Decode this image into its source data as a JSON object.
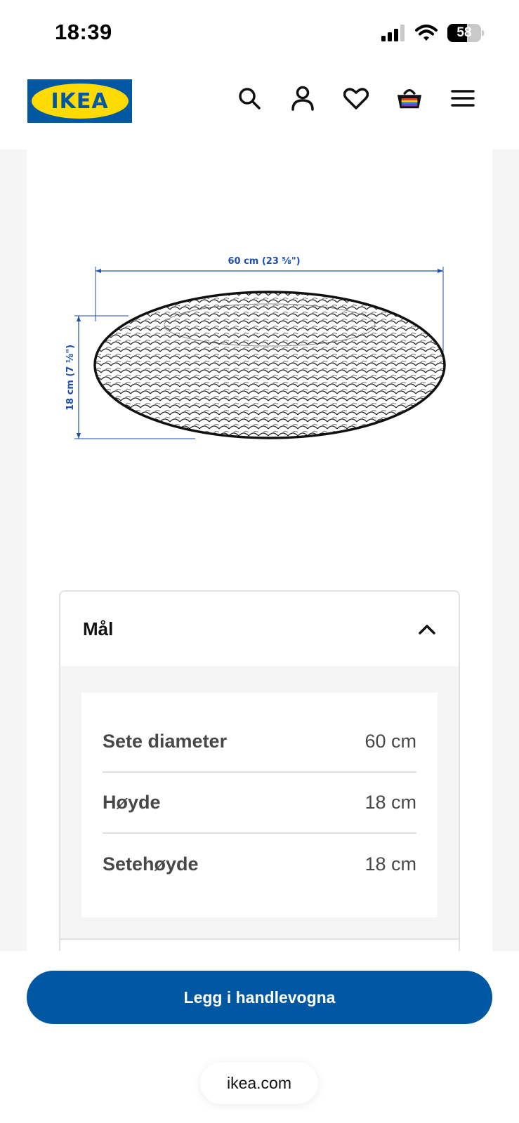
{
  "status_bar": {
    "time": "18:39",
    "battery_level": "58",
    "battery_fraction": 0.58,
    "icons": [
      "cellular-signal-icon",
      "wifi-icon",
      "battery-icon"
    ]
  },
  "header": {
    "logo_text": "IKEA",
    "icons": [
      "search-icon",
      "account-icon",
      "heart-icon",
      "cart-icon",
      "menu-icon"
    ],
    "brand_colors": {
      "blue": "#0058a3",
      "yellow": "#ffdb00"
    }
  },
  "drawing": {
    "width_label": "60 cm (23 ⅝\")",
    "height_label": "18 cm (7 ⅛\")",
    "dimension_color": "#1f4fb0"
  },
  "dimensions": {
    "title": "Mål",
    "rows": [
      {
        "label": "Sete diameter",
        "value": "60 cm"
      },
      {
        "label": "Høyde",
        "value": "18 cm"
      },
      {
        "label": "Setehøyde",
        "value": "18 cm"
      }
    ]
  },
  "cta": {
    "label": "Legg i handlevogna",
    "color": "#0058a3"
  },
  "browser": {
    "url": "ikea.com"
  }
}
